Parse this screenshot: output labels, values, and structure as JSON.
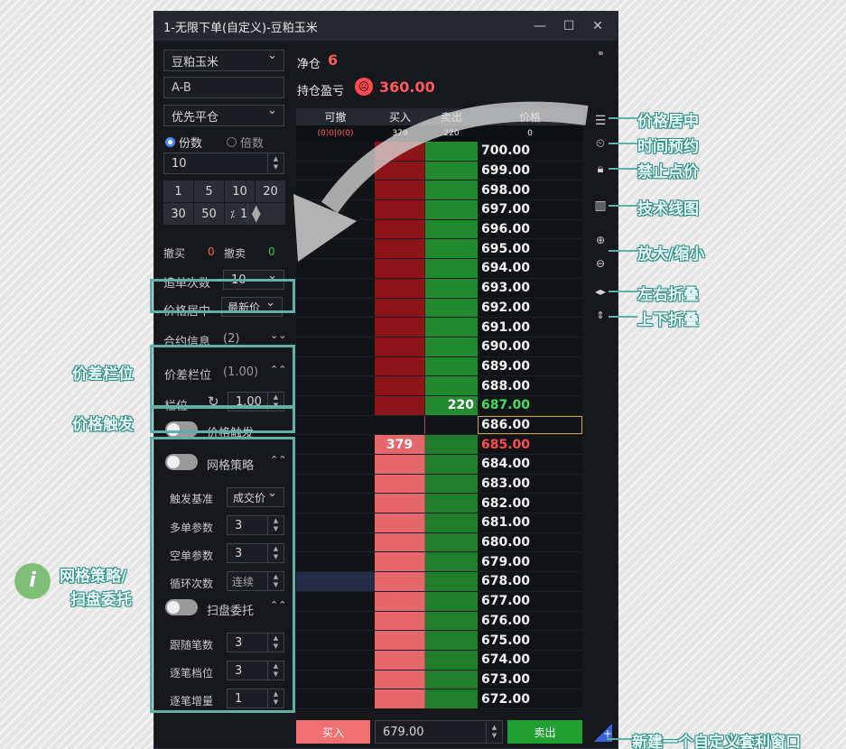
{
  "window": {
    "title": "1-无限下单(自定义)-豆粕玉米"
  },
  "left": {
    "contract": "豆粕玉米",
    "formula": "A-B",
    "priority": "优先平仓",
    "radio_share": "份数",
    "radio_multi": "倍数",
    "qty": "10",
    "quick": [
      "1",
      "5",
      "10",
      "20",
      "30",
      "50"
    ],
    "pct_label": "⁒",
    "pct_value": "1",
    "cancel_buy_label": "撤买",
    "cancel_buy_val": "0",
    "cancel_sell_label": "撤卖",
    "cancel_sell_val": "0",
    "chase_label": "追单次数",
    "chase_val": "10",
    "center_label": "价格居中",
    "center_val": "最新价",
    "contract_info": "合约信息",
    "contract_info_count": "(2)",
    "spread_title": "价差栏位",
    "spread_val": "(1.00)",
    "slot_label": "栏位",
    "slot_val": "1.00",
    "trigger_label": "价格触发",
    "grid_label": "网格策略",
    "base_label": "触发基准",
    "base_val": "成交价",
    "long_label": "多单参数",
    "long_val": "3",
    "short_label": "空单参数",
    "short_val": "3",
    "loop_label": "循环次数",
    "loop_val": "连续",
    "sweep_label": "扫盘委托",
    "follow_label": "跟随笔数",
    "follow_val": "3",
    "step_label": "逐笔档位",
    "step_val": "3",
    "inc_label": "逐笔增量",
    "inc_val": "1"
  },
  "top": {
    "net_label": "净仓",
    "net_val": "6",
    "pnl_label": "持仓盈亏",
    "pnl_val": "360.00"
  },
  "ladder": {
    "headers": [
      "可撤",
      "买入",
      "卖出",
      "价格"
    ],
    "sub_cancel": "(0)0|0(0)",
    "sub_buy": "379",
    "sub_sell": "220",
    "sub_price": "0",
    "buy_qty": "379",
    "sell_qty": "220",
    "prices": [
      "700.00",
      "699.00",
      "698.00",
      "697.00",
      "696.00",
      "695.00",
      "694.00",
      "693.00",
      "692.00",
      "691.00",
      "690.00",
      "689.00",
      "688.00",
      "687.00",
      "686.00",
      "685.00",
      "684.00",
      "683.00",
      "682.00",
      "681.00",
      "680.00",
      "679.00",
      "678.00",
      "677.00",
      "676.00",
      "675.00",
      "674.00",
      "673.00",
      "672.00"
    ]
  },
  "bottom": {
    "buy_btn": "买入",
    "price": "679.00",
    "sell_btn": "卖出"
  },
  "callouts": {
    "center": "价格居中",
    "time": "时间预约",
    "lock": "禁止点价",
    "chart": "技术线图",
    "zoom": "放大/缩小",
    "fold_lr": "左右折叠",
    "fold_ud": "上下折叠",
    "spread": "价差栏位",
    "trigger": "价格触发",
    "grid_1": "网格策略/",
    "grid_2": "扫盘委托",
    "new_window": "新建一个自定义套利窗口"
  },
  "colors": {
    "accent": "#5fb0a6",
    "buy": "#e6676b",
    "sell": "#22c55e",
    "profit": "#ff5a5f"
  }
}
